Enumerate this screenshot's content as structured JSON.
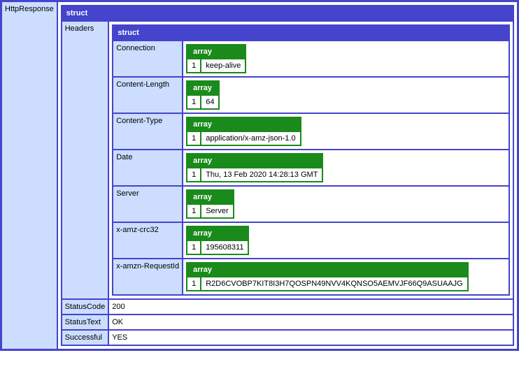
{
  "labels": {
    "struct": "struct",
    "array": "array",
    "httpResponse": "HttpResponse",
    "headers": "Headers",
    "statusCode": "StatusCode",
    "statusText": "StatusText",
    "successful": "Successful"
  },
  "response": {
    "statusCode": "200",
    "statusText": "OK",
    "successful": "YES",
    "headers": [
      {
        "name": "Connection",
        "index": "1",
        "value": "keep-alive"
      },
      {
        "name": "Content-Length",
        "index": "1",
        "value": "64"
      },
      {
        "name": "Content-Type",
        "index": "1",
        "value": "application/x-amz-json-1.0"
      },
      {
        "name": "Date",
        "index": "1",
        "value": "Thu, 13 Feb 2020 14:28:13 GMT"
      },
      {
        "name": "Server",
        "index": "1",
        "value": "Server"
      },
      {
        "name": "x-amz-crc32",
        "index": "1",
        "value": "195608311"
      },
      {
        "name": "x-amzn-RequestId",
        "index": "1",
        "value": "R2D6CVOBP7KIT8I3H7QOSPN49NVV4KQNSO5AEMVJF66Q9ASUAAJG"
      }
    ]
  }
}
